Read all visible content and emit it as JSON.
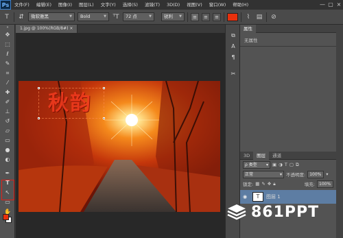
{
  "app": {
    "logo": "Ps"
  },
  "menu": [
    "文件(F)",
    "编辑(E)",
    "图像(I)",
    "图层(L)",
    "文字(Y)",
    "选择(S)",
    "滤镜(T)",
    "3D(D)",
    "视图(V)",
    "窗口(W)",
    "帮助(H)"
  ],
  "window_controls": {
    "minimize": "—",
    "restore": "▢",
    "close": "×"
  },
  "options": {
    "font_family": "微软雅黑",
    "font_style": "Bold",
    "font_size": "72 点",
    "antialias": "锐利",
    "text_color": "#e8300c"
  },
  "document": {
    "tab_title": "1.jpg @ 100%(RGB/8#)",
    "tab_close": "×",
    "canvas_text": "秋韵"
  },
  "properties_panel": {
    "tab": "属性",
    "body": "无属性"
  },
  "layers_panel": {
    "tabs": [
      "3D",
      "图层",
      "通道"
    ],
    "filter_label": "ρ 类型",
    "blend_mode": "正常",
    "opacity_label": "不透明度:",
    "opacity_value": "100%",
    "lock_label": "锁定:",
    "fill_label": "填充:",
    "fill_value": "100%",
    "layer_name": "图层 1"
  },
  "watermark": "861PPT"
}
